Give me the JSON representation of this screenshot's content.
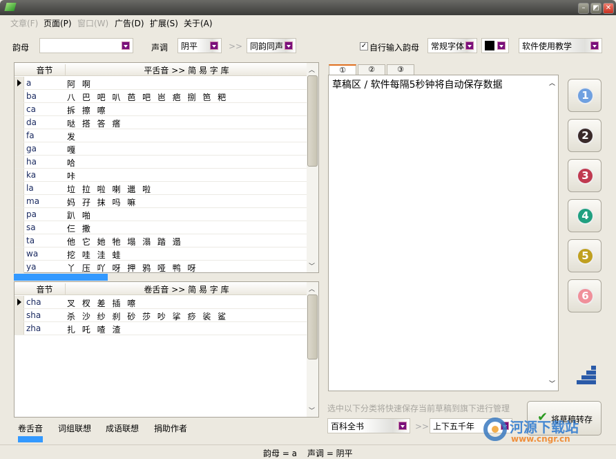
{
  "menu": [
    "文章(F)",
    "页面(P)",
    "窗口(W)",
    "广告(D)",
    "扩展(S)",
    "关于(A)"
  ],
  "toolbar": {
    "yunmu_label": "韵母",
    "yunmu_value": "",
    "shengdiao_label": "声调",
    "shengdiao_value": "阴平",
    "arrow": ">>",
    "mode_value": "同韵同声",
    "self_input_label": "自行输入韵母",
    "font_value": "常规字体",
    "color_value": "#000000",
    "tutorial_value": "软件使用教学"
  },
  "grid1": {
    "col1": "音节",
    "col2": "平舌音 >> 简 易 字 库",
    "rows": [
      [
        "a",
        "阿 啊"
      ],
      [
        "ba",
        "八 巴 吧 叭 芭 吧 岜 疤 捌 笆 粑"
      ],
      [
        "ca",
        "拆 擦 嚓"
      ],
      [
        "da",
        "哒 搭 答 瘩"
      ],
      [
        "fa",
        "发"
      ],
      [
        "ga",
        "嘎"
      ],
      [
        "ha",
        "哈"
      ],
      [
        "ka",
        "咔"
      ],
      [
        "la",
        "垃 拉 啦 喇 邋 啦"
      ],
      [
        "ma",
        "妈 孖 抹 吗 嘛"
      ],
      [
        "pa",
        "趴 啪"
      ],
      [
        "sa",
        "仨 撒"
      ],
      [
        "ta",
        "他 它 她 牠 塌 溻 踏 遢"
      ],
      [
        "wa",
        "挖 哇 洼 蛙"
      ],
      [
        "ya",
        "丫 压 吖 呀 押 鸦 哑 鸭 呀"
      ]
    ]
  },
  "grid2": {
    "col1": "音节",
    "col2": "卷舌音 >> 简 易 字 库",
    "rows": [
      [
        "cha",
        "叉 杈 差 插 嚓"
      ],
      [
        "sha",
        "杀 沙 纱 刹 砂 莎 吵 挲 痧 裟 鲨"
      ],
      [
        "zha",
        "扎 吒 喳 渣"
      ]
    ]
  },
  "bottom_tabs": [
    "卷舌音",
    "词组联想",
    "成语联想",
    "捐助作者"
  ],
  "editor": {
    "tabs": [
      "①",
      "②",
      "③"
    ],
    "text": "草稿区 / 软件每隔5秒钟将自动保存数据"
  },
  "side_buttons": [
    {
      "n": "1",
      "color": "#6fa0e0"
    },
    {
      "n": "2",
      "color": "#3a2a2a"
    },
    {
      "n": "3",
      "color": "#c03a50"
    },
    {
      "n": "4",
      "color": "#20a080"
    },
    {
      "n": "5",
      "color": "#c0a020"
    },
    {
      "n": "6",
      "color": "#f0909a"
    }
  ],
  "hint": "选中以下分类将快速保存当前草稿到旗下进行管理",
  "category1": "百科全书",
  "category2": "上下五千年",
  "save_button": "将草稿转存",
  "status": {
    "yunmu": "韵母 = a",
    "shengdiao": "声调 = 阴平"
  },
  "watermark": {
    "name": "河源下载站",
    "url": "www.cngr.cn"
  }
}
